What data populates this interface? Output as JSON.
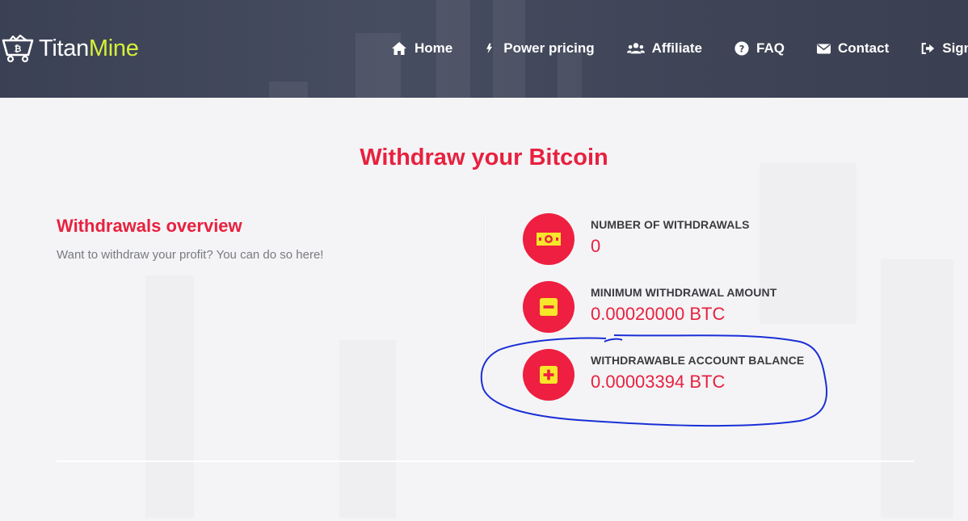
{
  "brand": {
    "name_part1": "Titan",
    "name_part2": "Mine",
    "colors": {
      "primary": "#e8213f",
      "accent": "#d6f03a",
      "header_bg": "#434959"
    }
  },
  "nav": {
    "items": [
      {
        "label": "Home",
        "icon": "home-icon"
      },
      {
        "label": "Power pricing",
        "icon": "bolt-icon"
      },
      {
        "label": "Affiliate",
        "icon": "users-icon"
      },
      {
        "label": "FAQ",
        "icon": "question-circle-icon"
      },
      {
        "label": "Contact",
        "icon": "envelope-icon"
      },
      {
        "label": "Sign Out",
        "icon": "sign-out-icon"
      }
    ]
  },
  "page": {
    "title": "Withdraw your Bitcoin"
  },
  "overview": {
    "title": "Withdrawals overview",
    "text": "Want to withdraw your profit? You can do so here!"
  },
  "stats": [
    {
      "label": "NUMBER OF WITHDRAWALS",
      "value": "0",
      "icon": "money-bill-icon"
    },
    {
      "label": "MINIMUM WITHDRAWAL AMOUNT",
      "value": "0.00020000 BTC",
      "icon": "minus-square-icon"
    },
    {
      "label": "WITHDRAWABLE ACCOUNT BALANCE",
      "value": "0.00003394 BTC",
      "icon": "plus-square-icon"
    }
  ]
}
